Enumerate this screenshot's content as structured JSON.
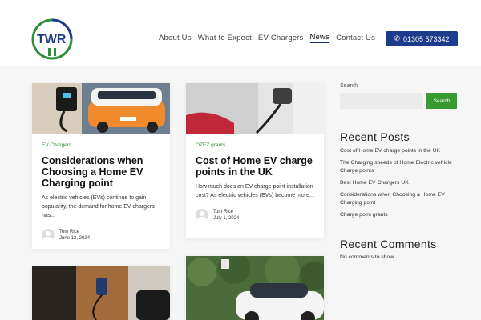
{
  "header": {
    "logo_text": "TWR",
    "nav": [
      {
        "label": "About Us",
        "active": false
      },
      {
        "label": "What to Expect",
        "active": false
      },
      {
        "label": "EV Chargers",
        "active": false
      },
      {
        "label": "News",
        "active": true
      },
      {
        "label": "Contact Us",
        "active": false
      }
    ],
    "phone": "01305 573342",
    "phone_icon": "phone-icon"
  },
  "posts": [
    {
      "category": "EV Chargers",
      "title": "Considerations when Choosing a Home EV Charging point",
      "excerpt": "As electric vehicles (EVs) continue to gain popularity, the demand for home EV chargers has...",
      "author": "Tom Rice",
      "date": "June 12, 2024"
    },
    {
      "category": "OZEZ grants",
      "title": "Cost of Home EV charge points in the UK",
      "excerpt": "How much does an EV charge point installation cost? As electric vehicles (EVs) become more...",
      "author": "Tom Rice",
      "date": "July 1, 2024"
    }
  ],
  "sidebar": {
    "search_label": "Search",
    "search_value": "",
    "search_button": "Search",
    "recent_posts_heading": "Recent Posts",
    "recent_posts": [
      "Cost of Home EV charge points in the UK",
      "The Charging speeds of Home Electric vehicle Charge points",
      "Best Home EV Chargers UK",
      "Considerations when Choosing a Home EV Charging point",
      "Charge point grants"
    ],
    "recent_comments_heading": "Recent Comments",
    "no_comments": "No comments to show."
  },
  "colors": {
    "brand_blue": "#1e3c8c",
    "accent_green": "#3a9a32"
  }
}
